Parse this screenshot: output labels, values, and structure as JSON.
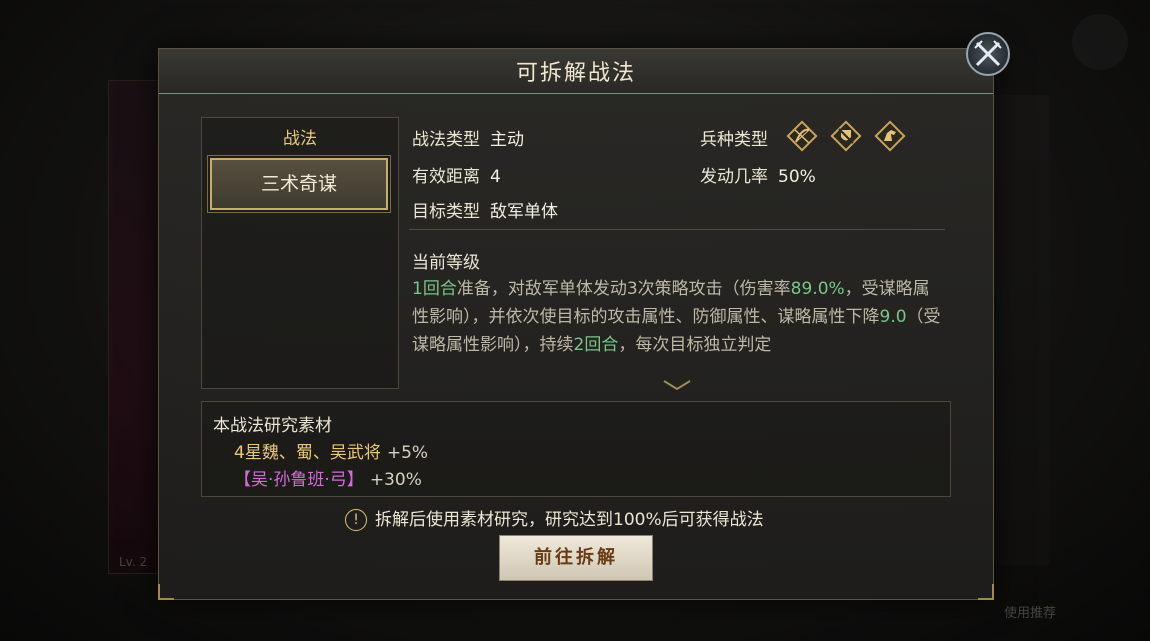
{
  "dialog": {
    "title": "可拆解战法",
    "close_icon": "crossed-swords-close-icon"
  },
  "skill_list": {
    "header": "战法",
    "items": [
      {
        "label": "三术奇谋",
        "selected": true
      }
    ]
  },
  "info": {
    "skill_type_label": "战法类型",
    "skill_type_value": "主动",
    "range_label": "有效距离",
    "range_value": "4",
    "target_label": "目标类型",
    "target_value": "敌军单体",
    "unit_type_label": "兵种类型",
    "unit_types": [
      "bow-icon",
      "shield-icon",
      "horse-icon"
    ],
    "trigger_label": "发动几率",
    "trigger_value": "50%"
  },
  "level": {
    "title": "当前等级",
    "desc_parts": [
      {
        "t": "1回合",
        "g": true
      },
      {
        "t": "准备，对敌军单体发动3次策略攻击（伤害率",
        "g": false
      },
      {
        "t": "89.0%",
        "g": true
      },
      {
        "t": "，受谋略属性影响），并依次使目标的攻击属性、防御属性、谋略属性下降",
        "g": false
      },
      {
        "t": "9.0",
        "g": true
      },
      {
        "t": "（受谋略属性影响），持续",
        "g": false
      },
      {
        "t": "2回合",
        "g": true
      },
      {
        "t": "，每次目标独立判定",
        "g": false
      }
    ]
  },
  "materials": {
    "title": "本战法研究素材",
    "row1_text": "4星魏、蜀、吴武将",
    "row1_bonus": "+5%",
    "row2_text": "【吴·孙鲁班·弓】",
    "row2_bonus": "+30%"
  },
  "note": {
    "icon": "exclamation-circle-icon",
    "text": "拆解后使用素材研究，研究达到100%后可获得战法"
  },
  "action": {
    "label": "前往拆解"
  },
  "background": {
    "level_text": "Lv. 2",
    "footer_text": "使用推荐"
  },
  "colors": {
    "accent_gold": "#e9c77d",
    "highlight_green": "#7cc48a",
    "purple_hero": "#d46bd8"
  }
}
